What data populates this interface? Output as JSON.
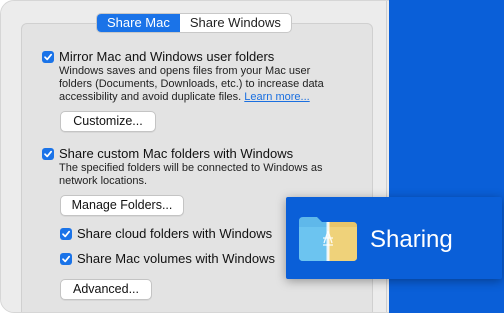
{
  "tabs": [
    {
      "label": "Share Mac",
      "active": true
    },
    {
      "label": "Share Windows",
      "active": false
    }
  ],
  "options": {
    "mirror": {
      "label": "Mirror Mac and Windows user folders",
      "checked": true,
      "desc_lines": [
        "Windows saves and opens files from your Mac user",
        "folders (Documents, Downloads, etc.) to increase data",
        "accessibility and avoid duplicate files."
      ],
      "link": "Learn more...",
      "button": "Customize..."
    },
    "custom": {
      "label": "Share custom Mac folders with Windows",
      "checked": true,
      "desc_lines": [
        "The specified folders will be connected to Windows as",
        "network locations."
      ],
      "button": "Manage Folders..."
    },
    "cloud": {
      "label": "Share cloud folders with Windows",
      "checked": true
    },
    "volumes": {
      "label": "Share Mac volumes with Windows",
      "checked": true
    },
    "advanced_button": "Advanced..."
  },
  "badge": {
    "label": "Sharing",
    "icon": "shared-folder-icon"
  },
  "colors": {
    "accent": "#1a73e8",
    "brand_blue": "#0a5fd8",
    "link": "#1a6fe0"
  }
}
